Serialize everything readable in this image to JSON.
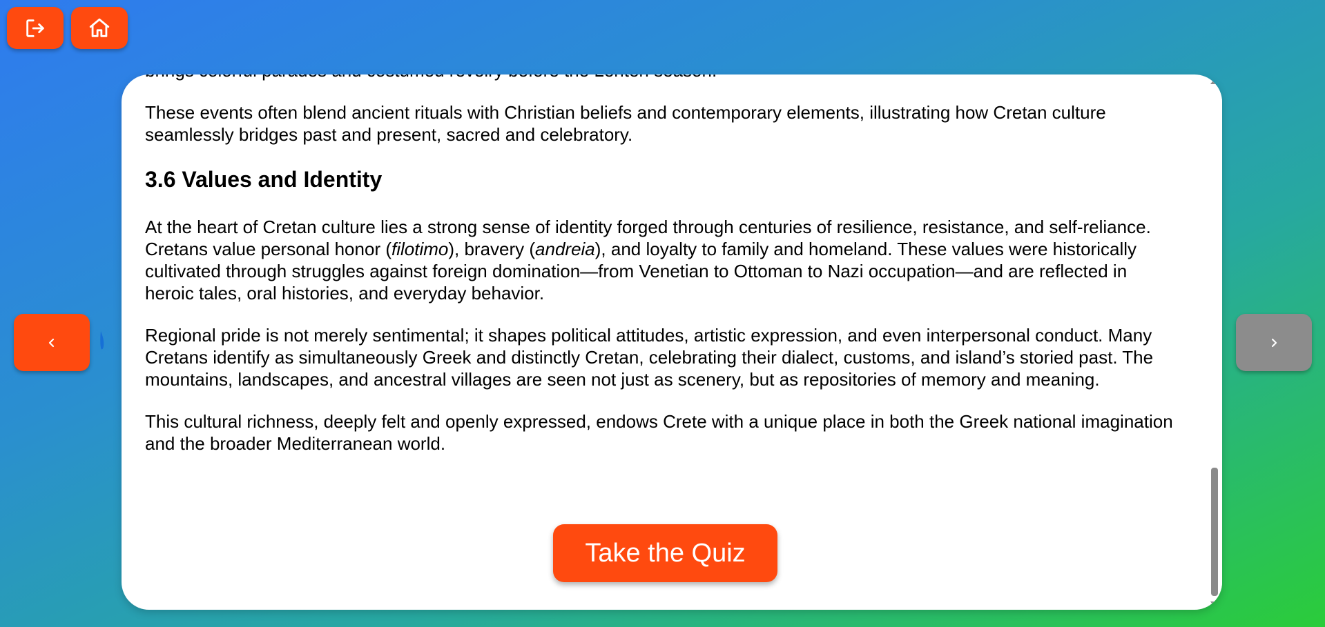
{
  "toolbar": {
    "logout_icon": "logout-icon",
    "home_icon": "home-icon"
  },
  "navigation": {
    "prev_icon": "chevron-left-icon",
    "next_icon": "chevron-right-icon"
  },
  "article": {
    "p_intro": "brings colorful parades and costumed revelry before the Lenten season.",
    "p_events": "These events often blend ancient rituals with Christian beliefs and contemporary elements, illustrating how Cretan culture seamlessly bridges past and present, sacred and celebratory.",
    "section_heading": "3.6 Values and Identity",
    "p_heart": {
      "a": "At the heart of Cretan culture lies a strong sense of identity forged through centuries of resilience, resistance, and self-reliance. Cretans value personal honor (",
      "em1": "filotimo",
      "b": "), bravery (",
      "em2": "andreia",
      "c": "), and loyalty to family and homeland. These values were historically cultivated through struggles against foreign domination—from Venetian to Ottoman to Nazi occupation—and are reflected in heroic tales, oral histories, and everyday behavior."
    },
    "p_pride": "Regional pride is not merely sentimental; it shapes political attitudes, artistic expression, and even interpersonal conduct. Many Cretans identify as simultaneously Greek and distinctly Cretan, celebrating their dialect, customs, and island’s storied past. The mountains, landscapes, and ancestral villages are seen not just as scenery, but as repositories of memory and meaning.",
    "p_richness": "This cultural richness, deeply felt and openly expressed, endows Crete with a unique place in both the Greek national imagination and the broader Mediterranean world."
  },
  "quiz_button_label": "Take the Quiz",
  "colors": {
    "accent": "#ff4a0f",
    "disabled": "#8c8c8c",
    "gradient_start": "#2f7bef",
    "gradient_end": "#2bcc3a"
  }
}
